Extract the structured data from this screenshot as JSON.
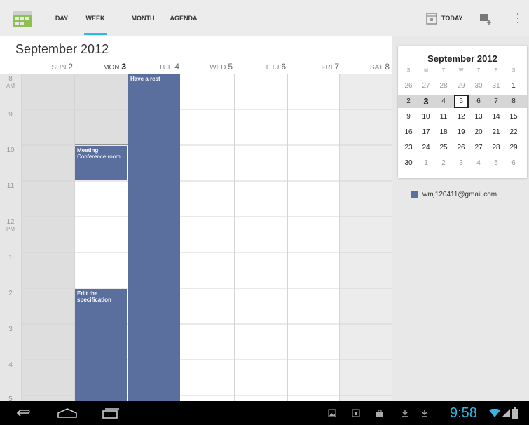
{
  "tabs": [
    {
      "label": "DAY",
      "active": false
    },
    {
      "label": "WEEK",
      "active": true
    },
    {
      "label": "MONTH",
      "active": false
    },
    {
      "label": "AGENDA",
      "active": false
    }
  ],
  "actions": {
    "today_label": "TODAY"
  },
  "month_title": "September 2012",
  "week_days": [
    {
      "name": "SUN",
      "num": "2"
    },
    {
      "name": "MON",
      "num": "3"
    },
    {
      "name": "TUE",
      "num": "4"
    },
    {
      "name": "WED",
      "num": "5"
    },
    {
      "name": "THU",
      "num": "6"
    },
    {
      "name": "FRI",
      "num": "7"
    },
    {
      "name": "SAT",
      "num": "8"
    }
  ],
  "hours": [
    {
      "num": "8",
      "ampm": "AM"
    },
    {
      "num": "9",
      "ampm": ""
    },
    {
      "num": "10",
      "ampm": ""
    },
    {
      "num": "11",
      "ampm": ""
    },
    {
      "num": "12",
      "ampm": "PM"
    },
    {
      "num": "1",
      "ampm": ""
    },
    {
      "num": "2",
      "ampm": ""
    },
    {
      "num": "3",
      "ampm": ""
    },
    {
      "num": "4",
      "ampm": ""
    },
    {
      "num": "5",
      "ampm": ""
    }
  ],
  "events": [
    {
      "title": "Have a rest",
      "sub": ""
    },
    {
      "title": "Meeting",
      "sub": "Conference room"
    },
    {
      "title": "Edit the specification",
      "sub": ""
    }
  ],
  "mini_calendar": {
    "title": "September 2012",
    "dow": [
      "S",
      "M",
      "T",
      "W",
      "T",
      "F",
      "S"
    ],
    "weeks": [
      [
        "26",
        "27",
        "28",
        "29",
        "30",
        "31",
        "1"
      ],
      [
        "2",
        "3",
        "4",
        "5",
        "6",
        "7",
        "8"
      ],
      [
        "9",
        "10",
        "11",
        "12",
        "13",
        "14",
        "15"
      ],
      [
        "16",
        "17",
        "18",
        "19",
        "20",
        "21",
        "22"
      ],
      [
        "23",
        "24",
        "25",
        "26",
        "27",
        "28",
        "29"
      ],
      [
        "30",
        "1",
        "2",
        "3",
        "4",
        "5",
        "6"
      ]
    ],
    "selected": "5"
  },
  "account": {
    "email": "wmj120411@gmail.com",
    "color": "#5a6f9e"
  },
  "status": {
    "time": "9:58"
  },
  "colors": {
    "event": "#5a6f9e",
    "accent": "#33b5e5"
  }
}
